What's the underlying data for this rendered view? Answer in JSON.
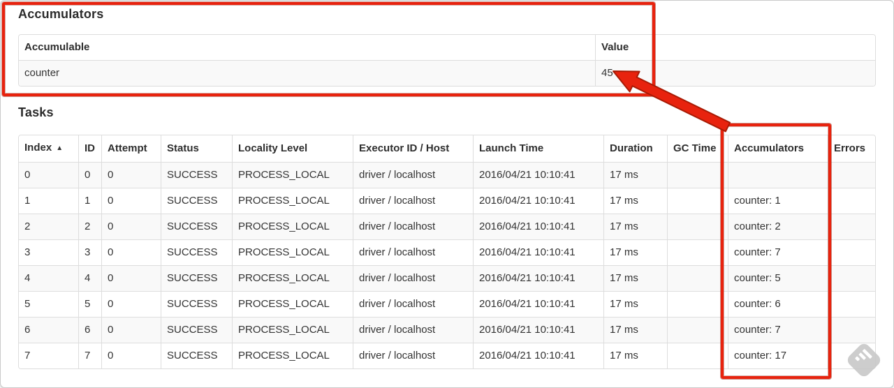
{
  "accumulators_section": {
    "heading": "Accumulators",
    "table": {
      "headers": [
        "Accumulable",
        "Value"
      ],
      "rows": [
        [
          "counter",
          "45"
        ]
      ]
    }
  },
  "tasks_section": {
    "heading": "Tasks",
    "table": {
      "sort_icon": "▲",
      "headers": [
        "Index",
        "ID",
        "Attempt",
        "Status",
        "Locality Level",
        "Executor ID / Host",
        "Launch Time",
        "Duration",
        "GC Time",
        "Accumulators",
        "Errors"
      ],
      "rows": [
        [
          "0",
          "0",
          "0",
          "SUCCESS",
          "PROCESS_LOCAL",
          "driver / localhost",
          "2016/04/21 10:10:41",
          "17 ms",
          "",
          "",
          ""
        ],
        [
          "1",
          "1",
          "0",
          "SUCCESS",
          "PROCESS_LOCAL",
          "driver / localhost",
          "2016/04/21 10:10:41",
          "17 ms",
          "",
          "counter: 1",
          ""
        ],
        [
          "2",
          "2",
          "0",
          "SUCCESS",
          "PROCESS_LOCAL",
          "driver / localhost",
          "2016/04/21 10:10:41",
          "17 ms",
          "",
          "counter: 2",
          ""
        ],
        [
          "3",
          "3",
          "0",
          "SUCCESS",
          "PROCESS_LOCAL",
          "driver / localhost",
          "2016/04/21 10:10:41",
          "17 ms",
          "",
          "counter: 7",
          ""
        ],
        [
          "4",
          "4",
          "0",
          "SUCCESS",
          "PROCESS_LOCAL",
          "driver / localhost",
          "2016/04/21 10:10:41",
          "17 ms",
          "",
          "counter: 5",
          ""
        ],
        [
          "5",
          "5",
          "0",
          "SUCCESS",
          "PROCESS_LOCAL",
          "driver / localhost",
          "2016/04/21 10:10:41",
          "17 ms",
          "",
          "counter: 6",
          ""
        ],
        [
          "6",
          "6",
          "0",
          "SUCCESS",
          "PROCESS_LOCAL",
          "driver / localhost",
          "2016/04/21 10:10:41",
          "17 ms",
          "",
          "counter: 7",
          ""
        ],
        [
          "7",
          "7",
          "0",
          "SUCCESS",
          "PROCESS_LOCAL",
          "driver / localhost",
          "2016/04/21 10:10:41",
          "17 ms",
          "",
          "counter: 17",
          ""
        ]
      ]
    }
  },
  "annotations": {
    "highlight_color": "#e8230e",
    "arrow_target_value": "45",
    "watermark_icon": "diamond-stripes"
  }
}
